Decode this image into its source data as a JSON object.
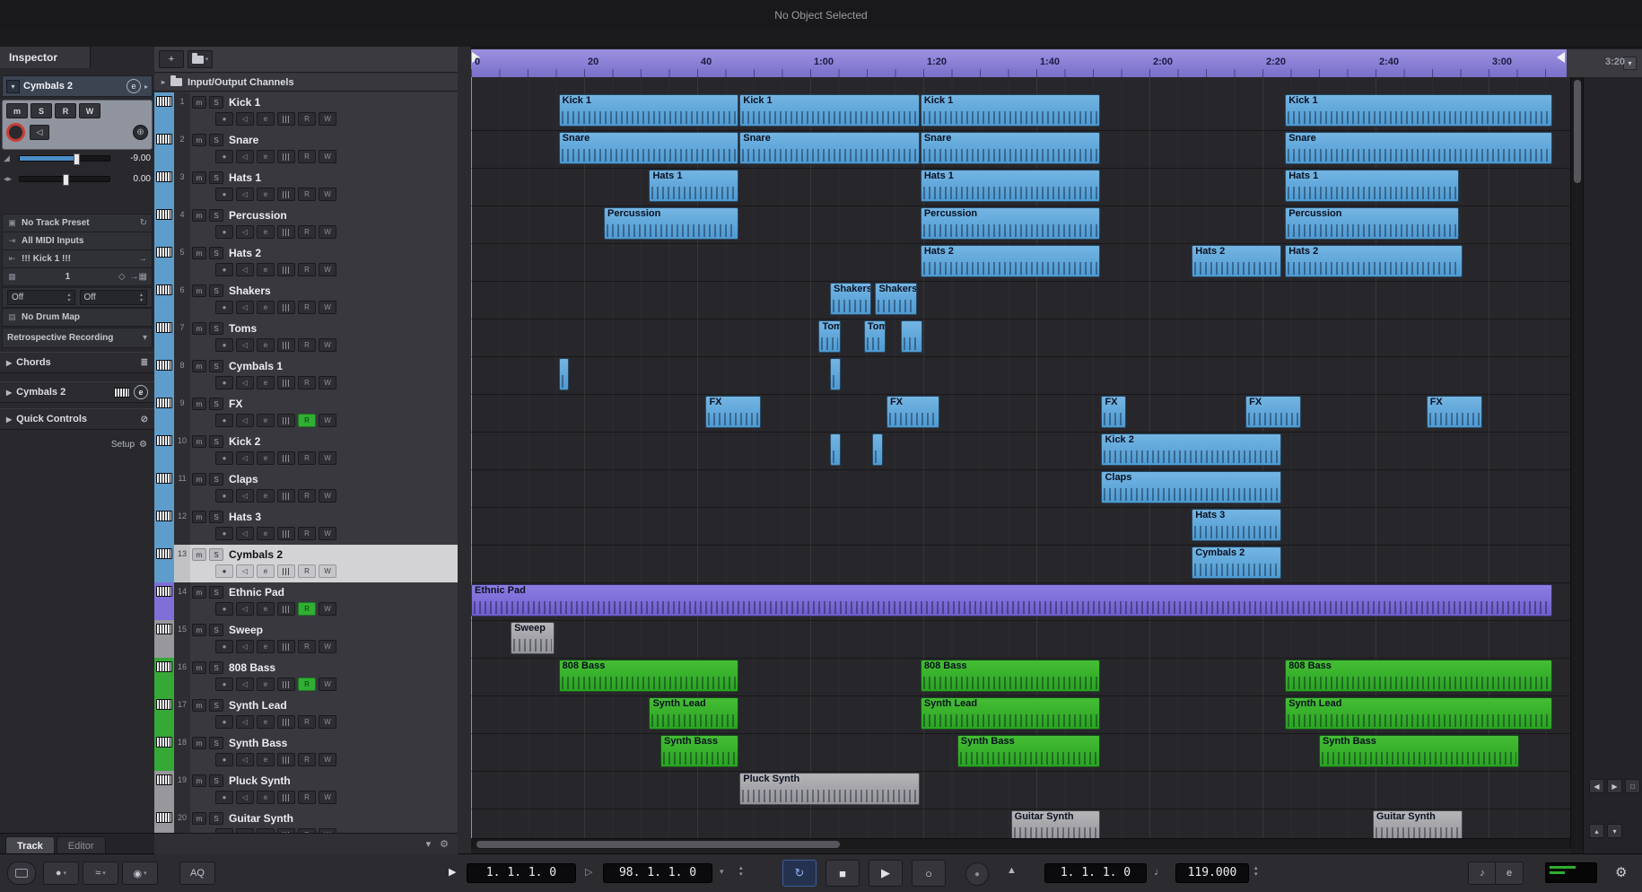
{
  "window": {
    "status": "No Object Selected"
  },
  "colors": {
    "blue": "#5d9ccb",
    "purple": "#7f6fd6",
    "grey": "#98989c",
    "green": "#36a836",
    "ruler": "#8d84d9"
  },
  "inspector": {
    "tab": "Inspector",
    "track_name": "Cymbals 2",
    "msrw": [
      "m",
      "S",
      "R",
      "W"
    ],
    "volume": "-9.00",
    "pan": "0.00",
    "preset": "No Track Preset",
    "midi_input": "All MIDI Inputs",
    "midi_output": "!!! Kick 1 !!!",
    "midi_channel": "1",
    "off_a": "Off",
    "off_b": "Off",
    "drum_map": "No Drum Map",
    "retrospective": "Retrospective Recording",
    "sections": [
      {
        "label": "Chords"
      },
      {
        "label": "Cymbals 2"
      },
      {
        "label": "Quick Controls"
      }
    ],
    "setup": "Setup",
    "tabs": [
      {
        "label": "Track",
        "active": true
      },
      {
        "label": "Editor",
        "active": false
      }
    ]
  },
  "track_list": {
    "io_label": "Input/Output Channels",
    "tracks": [
      {
        "num": 1,
        "name": "Kick 1",
        "color": "blue"
      },
      {
        "num": 2,
        "name": "Snare",
        "color": "blue"
      },
      {
        "num": 3,
        "name": "Hats 1",
        "color": "blue"
      },
      {
        "num": 4,
        "name": "Percussion",
        "color": "blue"
      },
      {
        "num": 5,
        "name": "Hats 2",
        "color": "blue"
      },
      {
        "num": 6,
        "name": "Shakers",
        "color": "blue"
      },
      {
        "num": 7,
        "name": "Toms",
        "color": "blue"
      },
      {
        "num": 8,
        "name": "Cymbals 1",
        "color": "blue"
      },
      {
        "num": 9,
        "name": "FX",
        "color": "blue",
        "read_on": true
      },
      {
        "num": 10,
        "name": "Kick 2",
        "color": "blue"
      },
      {
        "num": 11,
        "name": "Claps",
        "color": "blue"
      },
      {
        "num": 12,
        "name": "Hats 3",
        "color": "blue"
      },
      {
        "num": 13,
        "name": "Cymbals 2",
        "color": "blue",
        "selected": true
      },
      {
        "num": 14,
        "name": "Ethnic Pad",
        "color": "purple",
        "read_on": true
      },
      {
        "num": 15,
        "name": "Sweep",
        "color": "grey"
      },
      {
        "num": 16,
        "name": "808 Bass",
        "color": "green",
        "read_on": true
      },
      {
        "num": 17,
        "name": "Synth Lead",
        "color": "green"
      },
      {
        "num": 18,
        "name": "Synth Bass",
        "color": "green"
      },
      {
        "num": 19,
        "name": "Pluck Synth",
        "color": "grey"
      },
      {
        "num": 20,
        "name": "Guitar Synth",
        "color": "grey"
      }
    ]
  },
  "ruler": {
    "labels": [
      {
        "t": 0,
        "text": "0"
      },
      {
        "t": 20,
        "text": "20"
      },
      {
        "t": 40,
        "text": "40"
      },
      {
        "t": 60,
        "text": "1:00"
      },
      {
        "t": 80,
        "text": "1:20"
      },
      {
        "t": 100,
        "text": "1:40"
      },
      {
        "t": 120,
        "text": "2:00"
      },
      {
        "t": 140,
        "text": "2:20"
      },
      {
        "t": 160,
        "text": "2:40"
      },
      {
        "t": 180,
        "text": "3:00"
      },
      {
        "t": 200,
        "text": "3:20"
      }
    ]
  },
  "arrangement": {
    "clips": [
      {
        "track": 1,
        "label": "Kick 1",
        "start": 15.5,
        "end": 47.5,
        "color": "blue"
      },
      {
        "track": 1,
        "label": "Kick 1",
        "start": 47.5,
        "end": 79.5,
        "color": "blue"
      },
      {
        "track": 1,
        "label": "Kick 1",
        "start": 79.5,
        "end": 111.5,
        "color": "blue"
      },
      {
        "track": 1,
        "label": "Kick 1",
        "start": 144,
        "end": 191.5,
        "color": "blue"
      },
      {
        "track": 2,
        "label": "Snare",
        "start": 15.5,
        "end": 47.5,
        "color": "blue"
      },
      {
        "track": 2,
        "label": "Snare",
        "start": 47.5,
        "end": 79.5,
        "color": "blue"
      },
      {
        "track": 2,
        "label": "Snare",
        "start": 79.5,
        "end": 111.5,
        "color": "blue"
      },
      {
        "track": 2,
        "label": "Snare",
        "start": 144,
        "end": 191.5,
        "color": "blue"
      },
      {
        "track": 3,
        "label": "Hats 1",
        "start": 31.5,
        "end": 47.5,
        "color": "blue"
      },
      {
        "track": 3,
        "label": "Hats 1",
        "start": 79.5,
        "end": 111.5,
        "color": "blue"
      },
      {
        "track": 3,
        "label": "Hats 1",
        "start": 144,
        "end": 175,
        "color": "blue"
      },
      {
        "track": 4,
        "label": "Percussion",
        "start": 23.5,
        "end": 47.5,
        "color": "blue"
      },
      {
        "track": 4,
        "label": "Percussion",
        "start": 79.5,
        "end": 111.5,
        "color": "blue"
      },
      {
        "track": 4,
        "label": "Percussion",
        "start": 144,
        "end": 175,
        "color": "blue"
      },
      {
        "track": 5,
        "label": "Hats 2",
        "start": 79.5,
        "end": 111.5,
        "color": "blue"
      },
      {
        "track": 5,
        "label": "Hats 2",
        "start": 127.5,
        "end": 143.5,
        "color": "blue"
      },
      {
        "track": 5,
        "label": "Hats 2",
        "start": 144,
        "end": 175.5,
        "color": "blue"
      },
      {
        "track": 6,
        "label": "Shakers",
        "start": 63.5,
        "end": 71,
        "color": "blue"
      },
      {
        "track": 6,
        "label": "Shakers",
        "start": 71.5,
        "end": 79,
        "color": "blue"
      },
      {
        "track": 7,
        "label": "Tom",
        "start": 61.5,
        "end": 65.5,
        "color": "blue"
      },
      {
        "track": 7,
        "label": "Tom",
        "start": 69.5,
        "end": 73.5,
        "color": "blue"
      },
      {
        "track": 7,
        "label": "",
        "start": 76,
        "end": 80,
        "color": "blue"
      },
      {
        "track": 8,
        "label": "",
        "start": 15.5,
        "end": 17.5,
        "color": "blue"
      },
      {
        "track": 8,
        "label": "",
        "start": 63.5,
        "end": 65.5,
        "color": "blue"
      },
      {
        "track": 9,
        "label": "FX",
        "start": 41.5,
        "end": 51.5,
        "color": "blue"
      },
      {
        "track": 9,
        "label": "FX",
        "start": 73.5,
        "end": 83,
        "color": "blue"
      },
      {
        "track": 9,
        "label": "FX",
        "start": 111.5,
        "end": 116,
        "color": "blue"
      },
      {
        "track": 9,
        "label": "FX",
        "start": 137,
        "end": 147,
        "color": "blue"
      },
      {
        "track": 9,
        "label": "FX",
        "start": 169,
        "end": 179,
        "color": "blue"
      },
      {
        "track": 10,
        "label": "",
        "start": 63.5,
        "end": 65.5,
        "color": "blue"
      },
      {
        "track": 10,
        "label": "",
        "start": 71,
        "end": 73,
        "color": "blue"
      },
      {
        "track": 10,
        "label": "Kick 2",
        "start": 111.5,
        "end": 143.5,
        "color": "blue"
      },
      {
        "track": 11,
        "label": "Claps",
        "start": 111.5,
        "end": 143.5,
        "color": "blue"
      },
      {
        "track": 12,
        "label": "Hats 3",
        "start": 127.5,
        "end": 143.5,
        "color": "blue"
      },
      {
        "track": 13,
        "label": "Cymbals 2",
        "start": 127.5,
        "end": 143.5,
        "color": "blue"
      },
      {
        "track": 14,
        "label": "Ethnic Pad",
        "start": 0,
        "end": 191.5,
        "color": "purple"
      },
      {
        "track": 15,
        "label": "Sweep",
        "start": 7,
        "end": 15,
        "color": "grey"
      },
      {
        "track": 16,
        "label": "808 Bass",
        "start": 15.5,
        "end": 47.5,
        "color": "green"
      },
      {
        "track": 16,
        "label": "808 Bass",
        "start": 79.5,
        "end": 111.5,
        "color": "green"
      },
      {
        "track": 16,
        "label": "808 Bass",
        "start": 144,
        "end": 191.5,
        "color": "green"
      },
      {
        "track": 17,
        "label": "Synth Lead",
        "start": 31.5,
        "end": 47.5,
        "color": "green"
      },
      {
        "track": 17,
        "label": "Synth Lead",
        "start": 79.5,
        "end": 111.5,
        "color": "green"
      },
      {
        "track": 17,
        "label": "Synth Lead",
        "start": 144,
        "end": 191.5,
        "color": "green"
      },
      {
        "track": 18,
        "label": "Synth Bass",
        "start": 33.5,
        "end": 47.5,
        "color": "green"
      },
      {
        "track": 18,
        "label": "Synth Bass",
        "start": 86,
        "end": 111.5,
        "color": "green"
      },
      {
        "track": 18,
        "label": "Synth Bass",
        "start": 150,
        "end": 185.5,
        "color": "green"
      },
      {
        "track": 19,
        "label": "Pluck Synth",
        "start": 47.5,
        "end": 79.5,
        "color": "grey"
      },
      {
        "track": 20,
        "label": "Guitar Synth",
        "start": 95.5,
        "end": 111.5,
        "color": "grey"
      },
      {
        "track": 20,
        "label": "Guitar Synth",
        "start": 159.5,
        "end": 175.5,
        "color": "grey"
      }
    ]
  },
  "transport": {
    "aq": "AQ",
    "position": "1.  1.  1.   0",
    "locators": "98. 1. 1.  0",
    "position2": "1.  1.  1.   0",
    "tempo": "119.000"
  }
}
